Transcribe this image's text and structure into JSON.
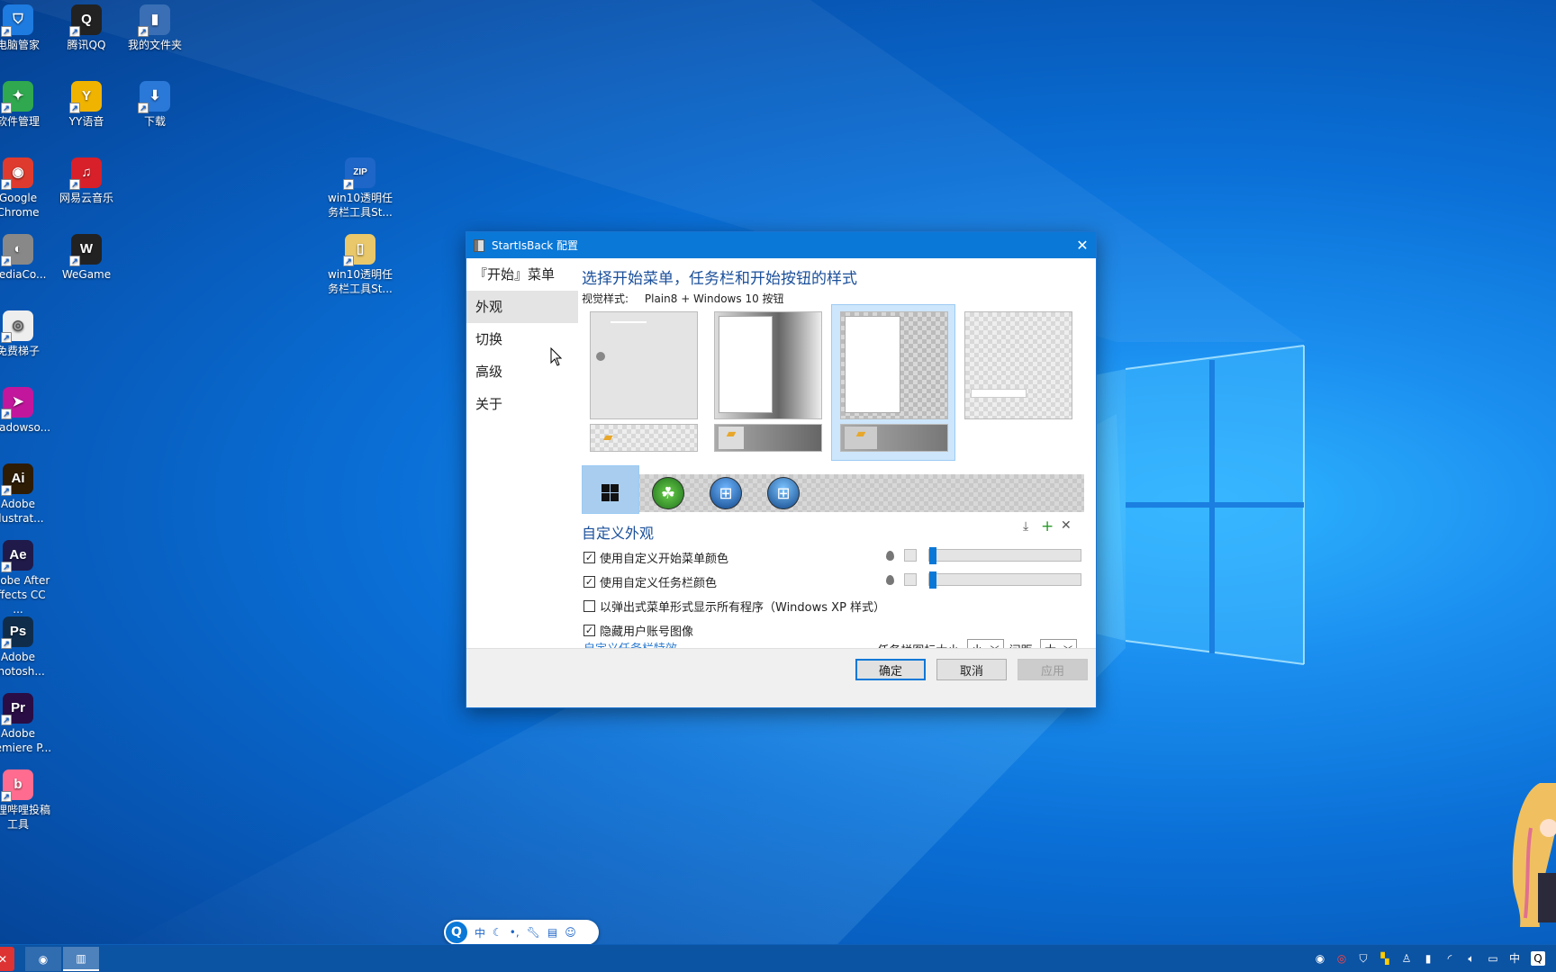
{
  "desktop": {
    "icons": [
      {
        "label": "电脑管家",
        "icon": "tencent-pc-manager-icon",
        "color": "#1e7be0"
      },
      {
        "label": "腾讯QQ",
        "icon": "qq-penguin-icon",
        "color": "#222222"
      },
      {
        "label": "我的文件夹",
        "icon": "folder-icon",
        "color": "#3a6fb5"
      },
      {
        "label": "软件管理",
        "icon": "software-manager-icon",
        "color": "#2fa84f"
      },
      {
        "label": "YY语音",
        "icon": "yy-voice-icon",
        "color": "#f0b400"
      },
      {
        "label": "下载",
        "icon": "download-icon",
        "color": "#2a78d8"
      },
      {
        "label": "Google Chrome",
        "icon": "chrome-icon",
        "color": "#de3b2e"
      },
      {
        "label": "网易云音乐",
        "icon": "netease-music-icon",
        "color": "#d8202a"
      },
      {
        "label": "win10透明任务栏工具St...",
        "icon": "zip-archive-icon",
        "color": "#1e66c8"
      },
      {
        "label": "MediaCo...",
        "icon": "media-coder-icon",
        "color": "#888888"
      },
      {
        "label": "WeGame",
        "icon": "wegame-icon",
        "color": "#222222"
      },
      {
        "label": "win10透明任务栏工具St...",
        "icon": "archive-file-icon",
        "color": "#e8c86a"
      },
      {
        "label": "免费梯子",
        "icon": "disc-icon",
        "color": "#eeeeee"
      },
      {
        "label": "Shadowso...",
        "icon": "paper-plane-icon",
        "color": "#c2179c"
      },
      {
        "label": "Adobe Illustrat...",
        "icon": "illustrator-icon",
        "color": "#2e1c05"
      },
      {
        "label": "Adobe After Effects CC ...",
        "icon": "after-effects-icon",
        "color": "#1f1a4a"
      },
      {
        "label": "Adobe Photosh...",
        "icon": "photoshop-icon",
        "color": "#0f2d4a"
      },
      {
        "label": "Adobe Premiere P...",
        "icon": "premiere-icon",
        "color": "#2a0d45"
      },
      {
        "label": "哔哩哔哩投稿工具",
        "icon": "bilibili-upload-icon",
        "color": "#ff6c8f"
      }
    ]
  },
  "window": {
    "title": "StartIsBack 配置",
    "nav": [
      "『开始』菜单",
      "外观",
      "切换",
      "高级",
      "关于"
    ],
    "nav_active": "外观",
    "heading": "选择开始菜单，任务栏和开始按钮的样式",
    "visual_style_label": "视觉样式:",
    "visual_style_value": "Plain8 + Windows 10 按钮",
    "custom_heading": "自定义外观",
    "options": [
      {
        "label": "使用自定义开始菜单颜色",
        "checked": true
      },
      {
        "label": "使用自定义任务栏颜色",
        "checked": true
      },
      {
        "label": "以弹出式菜单形式显示所有程序（Windows XP 样式）",
        "checked": false
      },
      {
        "label": "隐藏用户账号图像",
        "checked": true
      }
    ],
    "link": "自定义任务栏特效...",
    "icon_size_label": "任务栏图标大小:",
    "icon_size_value": "小",
    "spacing_label": "间距:",
    "spacing_value": "大",
    "buttons": {
      "ok": "确定",
      "cancel": "取消",
      "apply": "应用"
    },
    "accent": "#0a78d7"
  },
  "ime": {
    "mode": "中"
  },
  "taskbar": {
    "tray_lang": "中"
  }
}
